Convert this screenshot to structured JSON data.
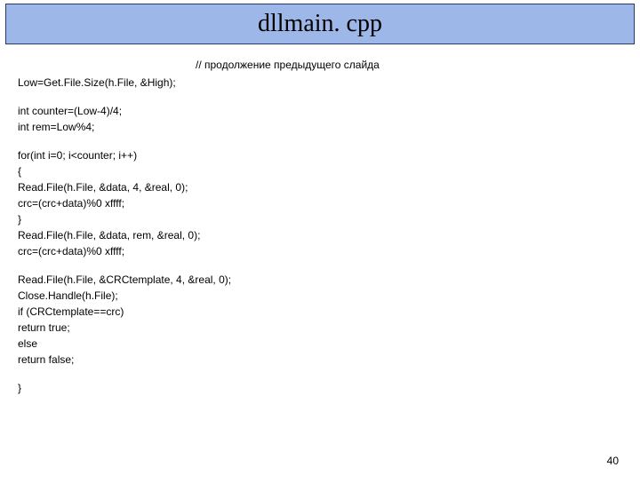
{
  "title": "dllmain. cpp",
  "comment": "//  продолжение предыдущего слайда",
  "code": {
    "l1": "Low=Get.File.Size(h.File, &High);",
    "l2": "int counter=(Low-4)/4;",
    "l3": "int rem=Low%4;",
    "l4": "for(int i=0; i<counter; i++)",
    "l5": "{",
    "l6": "Read.File(h.File, &data, 4, &real, 0);",
    "l7": "crc=(crc+data)%0 xffff;",
    "l8": "}",
    "l9": "Read.File(h.File, &data, rem, &real, 0);",
    "l10": "crc=(crc+data)%0 xffff;",
    "l11": "Read.File(h.File, &CRCtemplate, 4, &real, 0);",
    "l12": "Close.Handle(h.File);",
    "l13": "if (CRCtemplate==crc)",
    "l14": "return true;",
    "l15": "else",
    "l16": "return false;",
    "l17": "}"
  },
  "page_number": "40"
}
